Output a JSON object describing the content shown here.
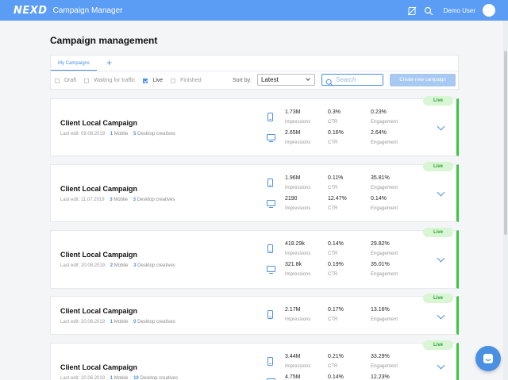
{
  "header": {
    "logo": "NEXD",
    "app_title": "Campaign Manager",
    "username": "Demo User",
    "icons": [
      "settings-icon",
      "search-icon"
    ]
  },
  "page": {
    "title": "Campaign management"
  },
  "tabs": [
    {
      "label": "My Campaigns",
      "active": true
    }
  ],
  "filters": [
    {
      "label": "Draft",
      "checked": false
    },
    {
      "label": "Waiting for traffic",
      "checked": false
    },
    {
      "label": "Live",
      "checked": true
    },
    {
      "label": "Finished",
      "checked": false
    }
  ],
  "sort": {
    "label": "Sort by:",
    "value": "Latest"
  },
  "search": {
    "placeholder": "Search"
  },
  "create_button": "Create new campaign",
  "labels": {
    "impressions": "Impressions",
    "ctr": "CTR",
    "engagement": "Engagement",
    "mobile": "Mobile",
    "desktop": "Desktop creatives",
    "status": "Live"
  },
  "campaigns": [
    {
      "name": "Client Local Campaign",
      "last_edit": "Last edit: 09.08.2019",
      "mobile": "1",
      "desktop": "5",
      "mobile_stats": {
        "impressions": "1.73M",
        "ctr": "0.3%",
        "engagement": "0.23%"
      },
      "desktop_stats": {
        "impressions": "2.65M",
        "ctr": "0.16%",
        "engagement": "2.64%"
      }
    },
    {
      "name": "Client Local Campaign",
      "last_edit": "Last edit: 11.07.2019",
      "mobile": "3",
      "desktop": "3",
      "mobile_stats": {
        "impressions": "1.96M",
        "ctr": "0.11%",
        "engagement": "35.81%"
      },
      "desktop_stats": {
        "impressions": "2190",
        "ctr": "12.47%",
        "engagement": "0.14%"
      }
    },
    {
      "name": "Client Local Campaign",
      "last_edit": "Last edit: 20.08.2019",
      "mobile": "2",
      "desktop": "3",
      "mobile_stats": {
        "impressions": "418.29k",
        "ctr": "0.14%",
        "engagement": "29.82%"
      },
      "desktop_stats": {
        "impressions": "321.8k",
        "ctr": "0.19%",
        "engagement": "35.01%"
      }
    },
    {
      "name": "Client Local Campaign",
      "last_edit": "Last edit: 20.06.2019",
      "mobile": "1",
      "desktop": "0",
      "mobile_stats": {
        "impressions": "2.17M",
        "ctr": "0.17%",
        "engagement": "13.16%"
      }
    },
    {
      "name": "Client Local Campaign",
      "last_edit": "Last edit: 20.06.2019",
      "mobile": "1",
      "desktop": "10",
      "mobile_stats": {
        "impressions": "3.44M",
        "ctr": "0.21%",
        "engagement": "33.29%"
      },
      "desktop_stats": {
        "impressions": "4.75M",
        "ctr": "0.14%",
        "engagement": "12.23%"
      }
    }
  ],
  "colors": {
    "brand": "#5b9cf4",
    "live": "#3cc543",
    "accent": "#4a90e2"
  }
}
